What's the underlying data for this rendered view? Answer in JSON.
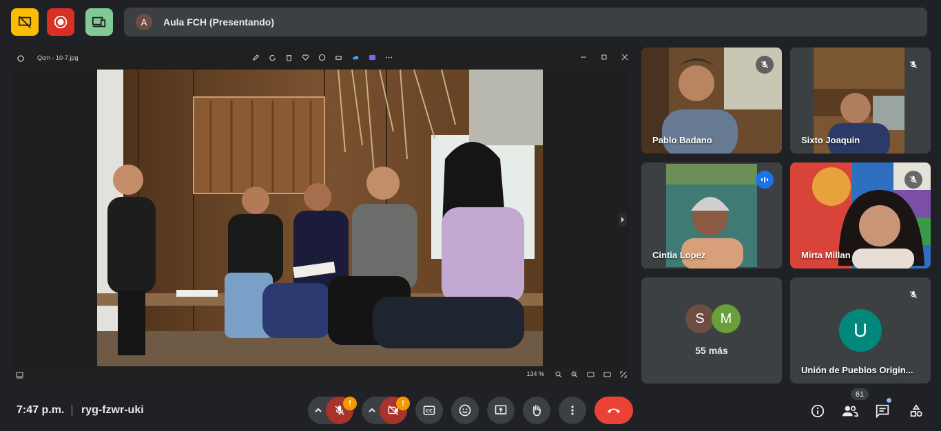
{
  "presentation": {
    "avatar_letter": "A",
    "title": "Aula FCH (Presentando)"
  },
  "shared_window": {
    "file_name": "Qcm - 10-7.jpg",
    "zoom": "134 %"
  },
  "participants": [
    {
      "name": "Pablo Badano",
      "muted": true
    },
    {
      "name": "Sixto Joaquin",
      "muted": true
    },
    {
      "name": "Cintia Lopez",
      "muted": false,
      "speaking": true
    },
    {
      "name": "Mirta Millan",
      "muted": true
    },
    {
      "name": "55 más",
      "avatars": [
        "S",
        "M"
      ]
    },
    {
      "name": "Unión de Pueblos Origin...",
      "avatar_letter": "U",
      "muted": true
    }
  ],
  "meeting": {
    "time": "7:47 p.m.",
    "code": "ryg-fzwr-uki",
    "participant_count": "61",
    "warning_mark": "!"
  },
  "colors": {
    "background": "#202124",
    "surface": "#3c4043",
    "top_yellow": "#fbbc04",
    "top_red": "#d93025",
    "top_green": "#81c995",
    "hangup_red": "#ea4335",
    "warning_orange": "#f29900",
    "speaking_blue": "#1a73e8",
    "avatar_s": "#6d4c41",
    "avatar_m": "#689f38",
    "avatar_u": "#00897b"
  }
}
